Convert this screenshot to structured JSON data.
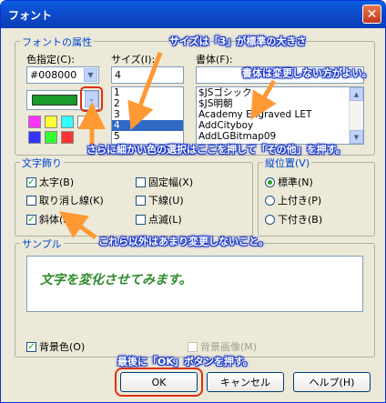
{
  "window": {
    "title": "フォント",
    "close_glyph": "✕"
  },
  "font_attr": {
    "legend": "フォントの属性",
    "color_label": "色指定(C):",
    "color_value": "#008000",
    "size_label": "サイズ(I):",
    "size_value": "4",
    "sizes": [
      "1",
      "2",
      "3",
      "4",
      "5"
    ],
    "selected_size": "4",
    "face_label": "書体(F):",
    "face_value": "",
    "faces": [
      "$JSゴシック",
      "$JS明朝",
      "Academy Engraved LET",
      "AddCityboy",
      "AddLGBitmap09"
    ],
    "current_color": "#1a9a28",
    "palette": [
      "#ff33ff",
      "#ffff33",
      "#33ffff",
      "#ffffff",
      "#3333ff",
      "#33ff33",
      "#ff3333"
    ]
  },
  "decoration": {
    "legend": "文字飾り",
    "bold": "太字(B)",
    "fixed": "固定幅(X)",
    "strike": "取り消し線(K)",
    "underline": "下線(U)",
    "italic": "斜体(I)",
    "blink": "点滅(L)"
  },
  "vpos": {
    "legend": "縦位置(V)",
    "standard": "標準(N)",
    "superscript": "上付き(P)",
    "subscript": "下付き(B)"
  },
  "sample": {
    "legend": "サンプル",
    "text": "文字を変化させてみます。",
    "text_color": "#2e8a2e"
  },
  "bottom": {
    "bg_color": "背景色(O)",
    "bg_image": "背景画像(M)"
  },
  "buttons": {
    "ok": "OK",
    "cancel": "キャンセル",
    "help": "ヘルプ(H)"
  },
  "annotations": {
    "size_note": "サイズは「3」が標準の大きさ",
    "face_note": "書体は変更しない方がよい。",
    "color_note": "さらに細かい色の選択はここを押して「その他」を押す。",
    "other_note": "これら以外はあまり変更しないこと。",
    "ok_note": "最後に「OK」ボタンを押す。",
    "annotation_color": "#1a37c9",
    "arrow_color": "#ff9933"
  }
}
